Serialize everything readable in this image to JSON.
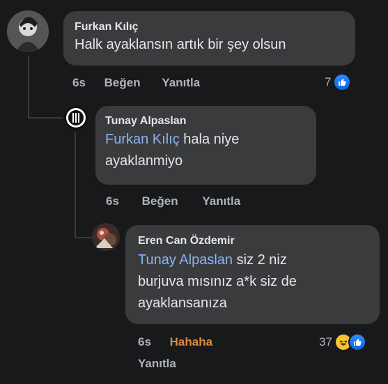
{
  "comments": [
    {
      "author": "Furkan Kılıç",
      "text": "Halk ayaklansın artık bir şey olsun",
      "time": "6s",
      "like_label": "Beğen",
      "reply_label": "Yanıtla",
      "reaction_count": "7",
      "reaction_icon": "like-icon"
    },
    {
      "author": "Tunay Alpaslan",
      "mention": "Furkan Kılıç",
      "text_line1": "hala niye",
      "text_line2": "ayaklanmiyo",
      "time": "6s",
      "like_label": "Beğen",
      "reply_label": "Yanıtla"
    },
    {
      "author": "Eren Can Özdemir",
      "mention": "Tunay Alpaslan",
      "text_line1": "siz 2 niz",
      "text_line2": "burjuva mısınız a*k siz de",
      "text_line3": "ayaklansanıza",
      "time": "6s",
      "reaction_label": "Hahaha",
      "reply_label": "Yanıtla",
      "reaction_count": "37",
      "reaction_icons": [
        "haha-icon",
        "like-icon"
      ]
    }
  ],
  "colors": {
    "background": "#18191a",
    "bubble": "#3a3b3c",
    "mention": "#8ab4f8",
    "meta": "#b0b3b8",
    "haha": "#e08a3c"
  }
}
